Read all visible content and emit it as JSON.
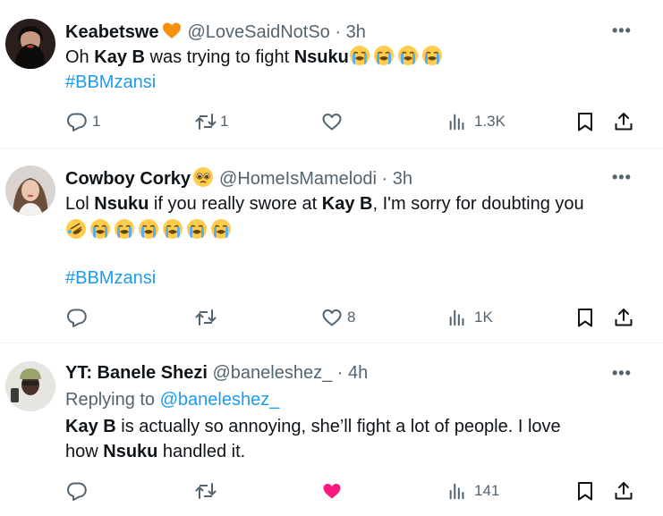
{
  "tweets": [
    {
      "author": "Keabetswe",
      "handle": "@LoveSaidNotSo",
      "dot": "·",
      "time": "3h",
      "more": "•••",
      "t1": "Oh ",
      "t2": "Kay B",
      "t3": " was trying to fight ",
      "t4": "Nsuku",
      "hashtag": "#BBMzansi",
      "replies": "1",
      "reposts": "1",
      "likes": "",
      "views": "1.3K"
    },
    {
      "author": "Cowboy Corky",
      "handle": "@HomeIsMamelodi",
      "dot": "·",
      "time": "3h",
      "more": "•••",
      "t1": "Lol ",
      "t2": "Nsuku",
      "t3": " if you really  swore at ",
      "t4": "Kay B",
      "t5": ", I'm sorry for doubting you",
      "hashtag": "#BBMzansi",
      "replies": "",
      "reposts": "",
      "likes": "8",
      "views": "1K"
    },
    {
      "author": "YT: Banele Shezi",
      "handle": "@baneleshez_",
      "dot": "·",
      "time": "4h",
      "more": "•••",
      "replying_prefix": "Replying to ",
      "replying_to": "@baneleshez_",
      "t1": "Kay B",
      "t2": " is actually so annoying, she’ll fight a lot of people. I love",
      "t3": "how ",
      "t4": "Nsuku",
      "t5": " handled it.",
      "replies": "",
      "reposts": "",
      "likes": "",
      "views": "141"
    }
  ],
  "colors": {
    "accent": "#1d9bf0",
    "muted": "#536471",
    "like": "#f91880",
    "text": "#0f1419"
  },
  "icons": [
    "reply-icon",
    "repost-icon",
    "like-icon",
    "views-icon",
    "bookmark-icon",
    "share-icon",
    "crying-emoji",
    "rofl-emoji",
    "orange-heart-emoji",
    "pleading-emoji"
  ]
}
